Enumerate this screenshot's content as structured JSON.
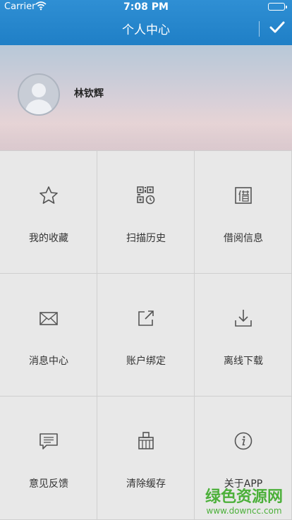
{
  "status_bar": {
    "carrier": "Carrier",
    "time": "7:08 PM",
    "wifi_icon": "wifi-icon",
    "battery_icon": "battery-icon"
  },
  "nav": {
    "title": "个人中心",
    "confirm_icon": "checkmark-icon"
  },
  "profile": {
    "avatar_icon": "avatar-placeholder-icon",
    "name": "林钦辉"
  },
  "menu": [
    {
      "label": "我的收藏",
      "icon": "star-icon"
    },
    {
      "label": "扫描历史",
      "icon": "qr-history-icon"
    },
    {
      "label": "借阅信息",
      "icon": "borrow-icon"
    },
    {
      "label": "消息中心",
      "icon": "mail-icon"
    },
    {
      "label": "账户绑定",
      "icon": "external-link-icon"
    },
    {
      "label": "离线下载",
      "icon": "download-icon"
    },
    {
      "label": "意见反馈",
      "icon": "feedback-icon"
    },
    {
      "label": "清除缓存",
      "icon": "broom-icon"
    },
    {
      "label": "关于APP",
      "icon": "info-icon"
    }
  ],
  "watermark": {
    "title": "绿色资源网",
    "url": "www.downcc.com"
  },
  "colors": {
    "header_blue": "#1f7fc6",
    "grid_background": "#e8e8e8",
    "watermark_green": "#4cb03a",
    "battery_green": "#4cd964"
  }
}
